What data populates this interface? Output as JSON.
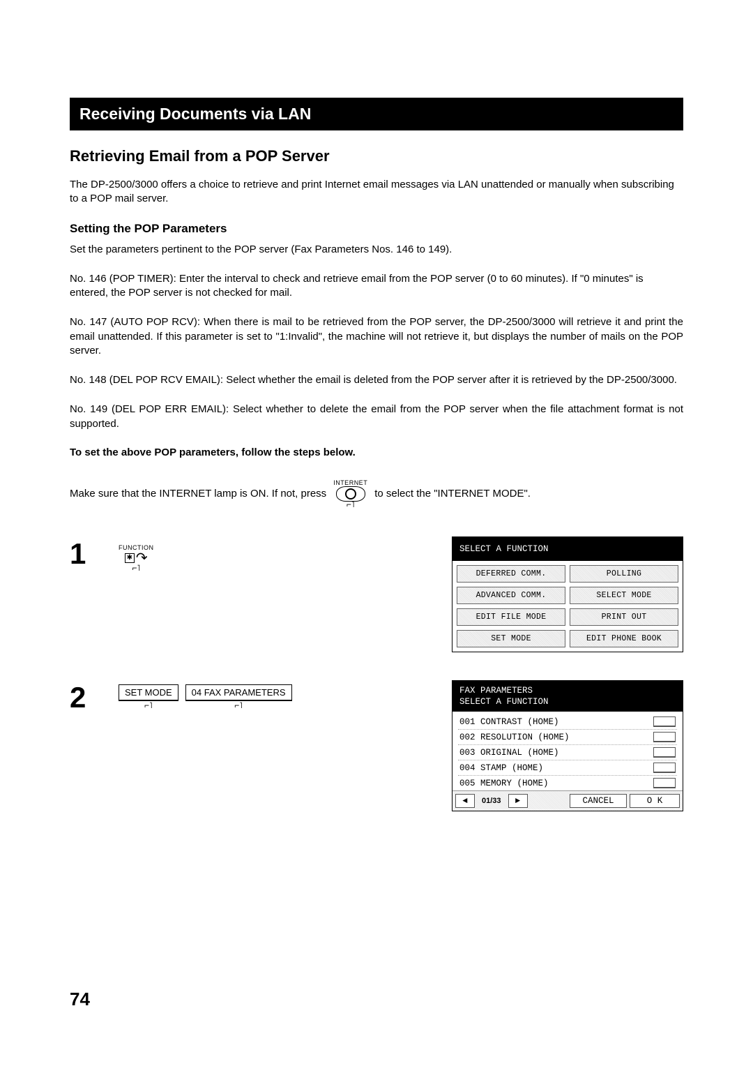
{
  "title_bar": "Receiving Documents via LAN",
  "main_heading": "Retrieving Email from a POP Server",
  "intro": "The DP-2500/3000 offers a choice to retrieve and print Internet email messages via LAN unattended or manually when subscribing to a POP mail server.",
  "sub_heading": "Setting the POP Parameters",
  "para1": "Set the parameters pertinent to the POP server (Fax Parameters Nos. 146 to 149).",
  "para2": "No. 146 (POP TIMER): Enter the interval to check and retrieve email from the POP server (0 to 60 minutes). If \"0 minutes\" is entered, the POP server is not checked for mail.",
  "para3": "No. 147 (AUTO POP RCV): When there is mail to be retrieved from the POP server, the DP-2500/3000 will retrieve it and print the email unattended.  If this parameter is set to \"1:Invalid\", the machine will not retrieve it, but displays the number of mails on the POP server.",
  "para4": "No. 148 (DEL POP RCV EMAIL): Select whether the email is deleted from the POP server after it is retrieved by the DP-2500/3000.",
  "para5": "No. 149 (DEL POP ERR EMAIL): Select whether to delete the email from the POP server when the file attachment format is not supported.",
  "bold_line": "To set the above POP parameters, follow the steps below.",
  "instr_before": "Make sure that the INTERNET lamp is ON.  If not, press",
  "instr_after": " to select the \"INTERNET MODE\".",
  "internet_label": "INTERNET",
  "function_label": "FUNCTION",
  "step1_num": "1",
  "step2_num": "2",
  "step2_btn1": "SET MODE",
  "step2_btn2": "04 FAX PARAMETERS",
  "lcd1": {
    "header": "SELECT A FUNCTION",
    "buttons": [
      "DEFERRED COMM.",
      "POLLING",
      "ADVANCED COMM.",
      "SELECT MODE",
      "EDIT FILE MODE",
      "PRINT OUT",
      "SET MODE",
      "EDIT PHONE BOOK"
    ]
  },
  "lcd2": {
    "header_line1": "FAX PARAMETERS",
    "header_line2": "SELECT A FUNCTION",
    "rows": [
      "001 CONTRAST (HOME)",
      "002 RESOLUTION (HOME)",
      "003 ORIGINAL (HOME)",
      "004 STAMP (HOME)",
      "005 MEMORY (HOME)"
    ],
    "page_indicator": "01/33",
    "cancel": "CANCEL",
    "ok": "O K"
  },
  "page_number": "74"
}
